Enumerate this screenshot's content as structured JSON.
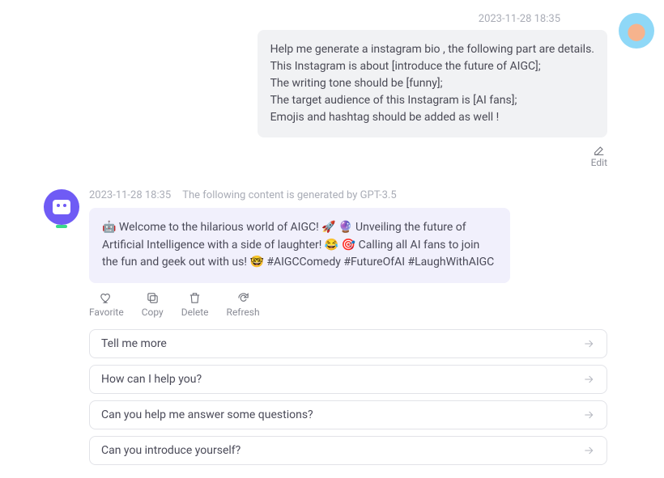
{
  "user_message": {
    "timestamp": "2023-11-28 18:35",
    "text": "Help me generate a instagram bio , the following part are details.\nThis Instagram is about [introduce the future of AIGC];\nThe writing tone should be [funny];\nThe target audience of this Instagram is [AI fans];\nEmojis and hashtag should be added as well !",
    "edit_label": "Edit"
  },
  "bot_message": {
    "timestamp": "2023-11-28 18:35",
    "generator_note": "The following content is generated by GPT-3.5",
    "text": "🤖 Welcome to the hilarious world of AIGC! 🚀 🔮 Unveiling the future of Artificial Intelligence with a side of laughter! 😂 🎯 Calling all AI fans to join the fun and geek out with us! 🤓 #AIGCComedy #FutureOfAI #LaughWithAIGC"
  },
  "actions": {
    "favorite": "Favorite",
    "copy": "Copy",
    "delete": "Delete",
    "refresh": "Refresh"
  },
  "suggestions": [
    "Tell me more",
    "How can I help you?",
    "Can you help me answer some questions?",
    "Can you introduce yourself?"
  ]
}
